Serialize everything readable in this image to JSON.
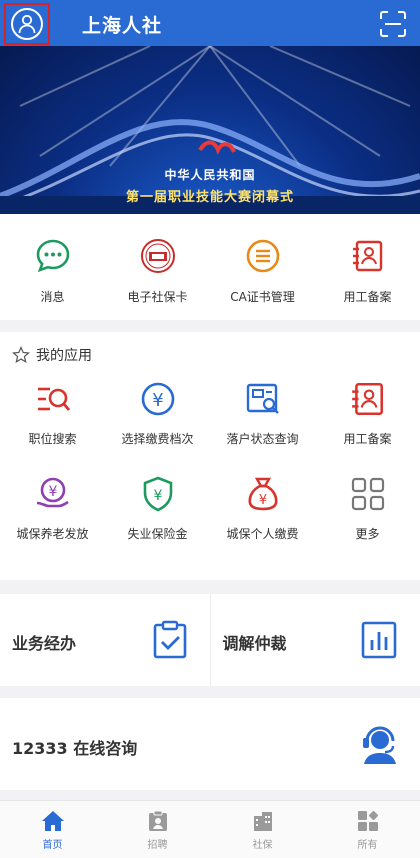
{
  "header": {
    "title": "上海人社",
    "avatar_icon": "user-icon",
    "scan_icon": "scan-icon",
    "bg": "#2a6ad3"
  },
  "banner": {
    "line1": "中华人民共和国",
    "line2": "第一届职业技能大赛闭幕式",
    "dots_total": 5,
    "active_dot": 1
  },
  "quick": [
    {
      "label": "消息",
      "icon": "message-icon"
    },
    {
      "label": "电子社保卡",
      "icon": "social-card-icon"
    },
    {
      "label": "CA证书管理",
      "icon": "certificate-icon"
    },
    {
      "label": "用工备案",
      "icon": "employment-record-icon"
    }
  ],
  "my_apps": {
    "title": "我的应用",
    "items": [
      {
        "label": "职位搜索",
        "icon": "job-search-icon"
      },
      {
        "label": "选择缴费档次",
        "icon": "payment-level-icon"
      },
      {
        "label": "落户状态查询",
        "icon": "settlement-query-icon"
      },
      {
        "label": "用工备案",
        "icon": "employment-record-icon"
      },
      {
        "label": "城保养老发放",
        "icon": "pension-icon"
      },
      {
        "label": "失业保险金",
        "icon": "unemployment-insurance-icon"
      },
      {
        "label": "城保个人缴费",
        "icon": "money-bag-icon"
      },
      {
        "label": "更多",
        "icon": "more-grid-icon"
      }
    ]
  },
  "cards": {
    "business": {
      "label": "业务经办",
      "icon": "clipboard-check-icon"
    },
    "mediation": {
      "label": "调解仲裁",
      "icon": "bar-chart-icon"
    },
    "consult": {
      "label": "12333 在线咨询",
      "icon": "headset-icon"
    }
  },
  "tabbar": [
    {
      "label": "首页",
      "icon": "home-icon",
      "active": true
    },
    {
      "label": "招聘",
      "icon": "recruit-icon",
      "active": false
    },
    {
      "label": "社保",
      "icon": "building-icon",
      "active": false
    },
    {
      "label": "所有",
      "icon": "all-apps-icon",
      "active": false
    }
  ]
}
